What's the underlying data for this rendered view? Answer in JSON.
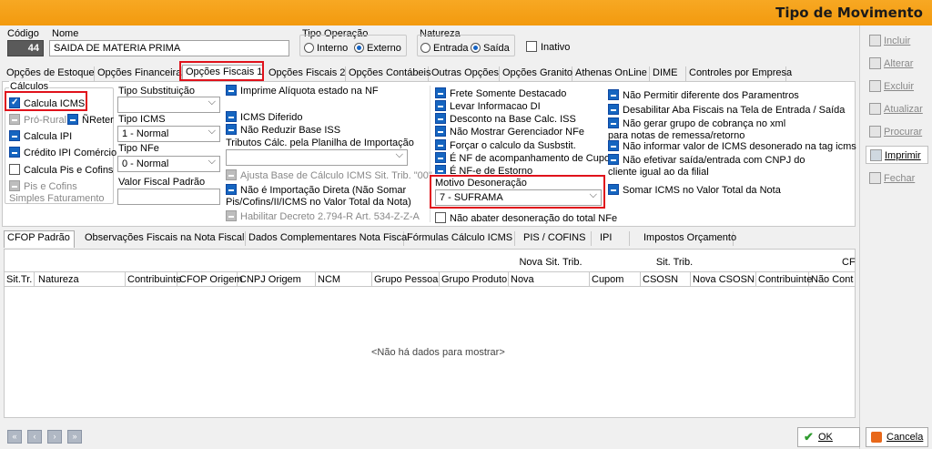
{
  "window": {
    "title": "Tipo de Movimento"
  },
  "header": {
    "codigo_label": "Código",
    "codigo_value": "44",
    "nome_label": "Nome",
    "nome_value": "SAIDA DE MATERIA PRIMA",
    "tipo_operacao_label": "Tipo Operação",
    "tipo_operacao_options": [
      "Interno",
      "Externo"
    ],
    "tipo_operacao_selected": "Externo",
    "natureza_label": "Natureza",
    "natureza_options": [
      "Entrada",
      "Saída"
    ],
    "natureza_selected": "Saída",
    "inativo_label": "Inativo"
  },
  "tabs": [
    "Opções de Estoque",
    "Opções Financeiras",
    "Opções Fiscais 1",
    "Opções Fiscais 2",
    "Opções Contábeis",
    "Outras Opções",
    "Opções Granito",
    "Athenas OnLine",
    "DIME",
    "Controles por Empresa"
  ],
  "active_tab": "Opções Fiscais 1",
  "calculos": {
    "label": "Cálculos",
    "calcula_icms": "Calcula ICMS",
    "pro_rural": "Pró-Rural",
    "nreter": "ÑReter",
    "calcula_ipi": "Calcula IPI",
    "credito_ipi": "Crédito IPI Comércio",
    "calcula_pis": "Calcula Pis e Cofins",
    "pis_simples": "Pis e Cofins Simples Faturamento"
  },
  "col2": {
    "tipo_substituicao_label": "Tipo Substituição",
    "tipo_substituicao_value": "",
    "tipo_icms_label": "Tipo ICMS",
    "tipo_icms_value": "1 - Normal",
    "tipo_nfe_label": "Tipo NFe",
    "tipo_nfe_value": "0 - Normal",
    "valor_fiscal_label": "Valor Fiscal Padrão",
    "valor_fiscal_value": ""
  },
  "col3": {
    "imprime_aliquota": "Imprime Alíquota estado na NF",
    "icms_diferido": "ICMS Diferido",
    "nao_reduzir_iss": "Não Reduzir Base ISS",
    "tributos_label": "Tributos Cálc. pela Planilha de Importação",
    "tributos_value": "",
    "ajusta_base": "Ajusta Base de Cálculo ICMS Sit. Trib. \"00\"",
    "nao_importacao": "Não é Importação Direta (Não Somar Pis/Cofins/II/ICMS  no Valor Total da Nota)",
    "habilitar_decreto": "Habilitar Decreto 2.794-R Art. 534-Z-Z-A"
  },
  "col4": {
    "frete": "Frete Somente Destacado",
    "levar_di": "Levar Informacao DI",
    "desconto": "Desconto na Base Calc. ISS",
    "nao_mostrar": "Não Mostrar Gerenciador NFe",
    "forcar": "Forçar o calculo da Susbstit.",
    "nf_acomp": "É NF de acompanhamento de Cupom",
    "nfe_estorno": "É NF-e de Estorno",
    "motivo_label": "Motivo Desoneração",
    "motivo_value": "7 - SUFRAMA",
    "nao_abater": "Não abater desoneração do total NFe"
  },
  "col5": {
    "nao_permitir": "Não Permitir diferente dos Paramentros",
    "desabilitar_aba": "Desabilitar Aba Fiscais na Tela de Entrada / Saída",
    "nao_gerar": "Não gerar grupo de cobrança no xml para notas de remessa/retorno",
    "nao_informar": "Não informar valor de ICMS desonerado na tag icms",
    "nao_efetivar": "Não efetivar saída/entrada com CNPJ do cliente igual ao da filial",
    "somar_icms": "Somar ICMS no Valor Total da Nota"
  },
  "lower_tabs": [
    "CFOP Padrão",
    "Observações Fiscais na Nota Fiscal",
    "Dados Complementares Nota Fiscal",
    "Fórmulas Cálculo ICMS",
    "PIS / COFINS",
    "IPI",
    "Impostos Orçamento"
  ],
  "grid": {
    "group_headers": [
      "Nova Sit. Trib.",
      "Sit. Trib.",
      "CF"
    ],
    "columns": [
      "Sit.Tr.",
      "Natureza",
      "Contribuinte",
      "CFOP Origem",
      "CNPJ Origem",
      "NCM",
      "Grupo Pessoa",
      "Grupo Produto",
      "Nova",
      "Cupom",
      "CSOSN",
      "Nova CSOSN",
      "Contribuinte",
      "Não Cont"
    ],
    "empty_text": "<Não há dados para mostrar>"
  },
  "side_buttons": [
    "Incluir",
    "Alterar",
    "Excluir",
    "Atualizar",
    "Procurar",
    "Imprimir",
    "Fechar"
  ],
  "footer": {
    "ok": "OK",
    "cancel": "Cancela"
  }
}
